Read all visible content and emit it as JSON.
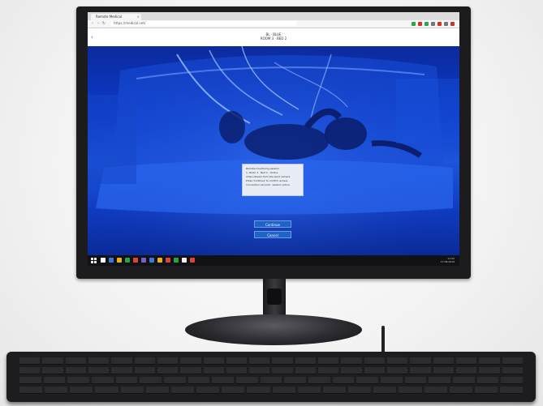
{
  "browser": {
    "tab_title": "Remote Medical",
    "tab_close": "×",
    "address": "https://medical.net/",
    "nav_back": "‹",
    "nav_forward": "›",
    "nav_reload": "↻",
    "extension_colors": [
      "#2ea44f",
      "#d93025",
      "#2ea44f",
      "#777777",
      "#d93025",
      "#777777",
      "#c0392b"
    ]
  },
  "page": {
    "back": "‹",
    "header_line1": "BL · BLUE",
    "header_line2": "ROOM 3 · BED 2"
  },
  "dialog": {
    "lines": [
      "Remote monitoring session",
      "1. Room 3 · Bed 2 · Online",
      "Video stream from the ward camera",
      "Press 'Continue' to confirm access",
      "Connection secured · session active"
    ]
  },
  "buttons": {
    "continue": "Continue",
    "cancel": "Cancel"
  },
  "taskbar": {
    "icon_colors": [
      "#ffffff",
      "#3a78d8",
      "#e8b21c",
      "#2e9e47",
      "#d9453d",
      "#7b5cc8",
      "#3a78d8",
      "#e8b21c",
      "#d9453d",
      "#2e9e47",
      "#f0f0f0",
      "#d9453d"
    ],
    "tray_time": "11:52",
    "tray_date": "17.06.2019"
  },
  "colors": {
    "accent": "#1f62c8",
    "video_blue": "#0c3cd0"
  }
}
